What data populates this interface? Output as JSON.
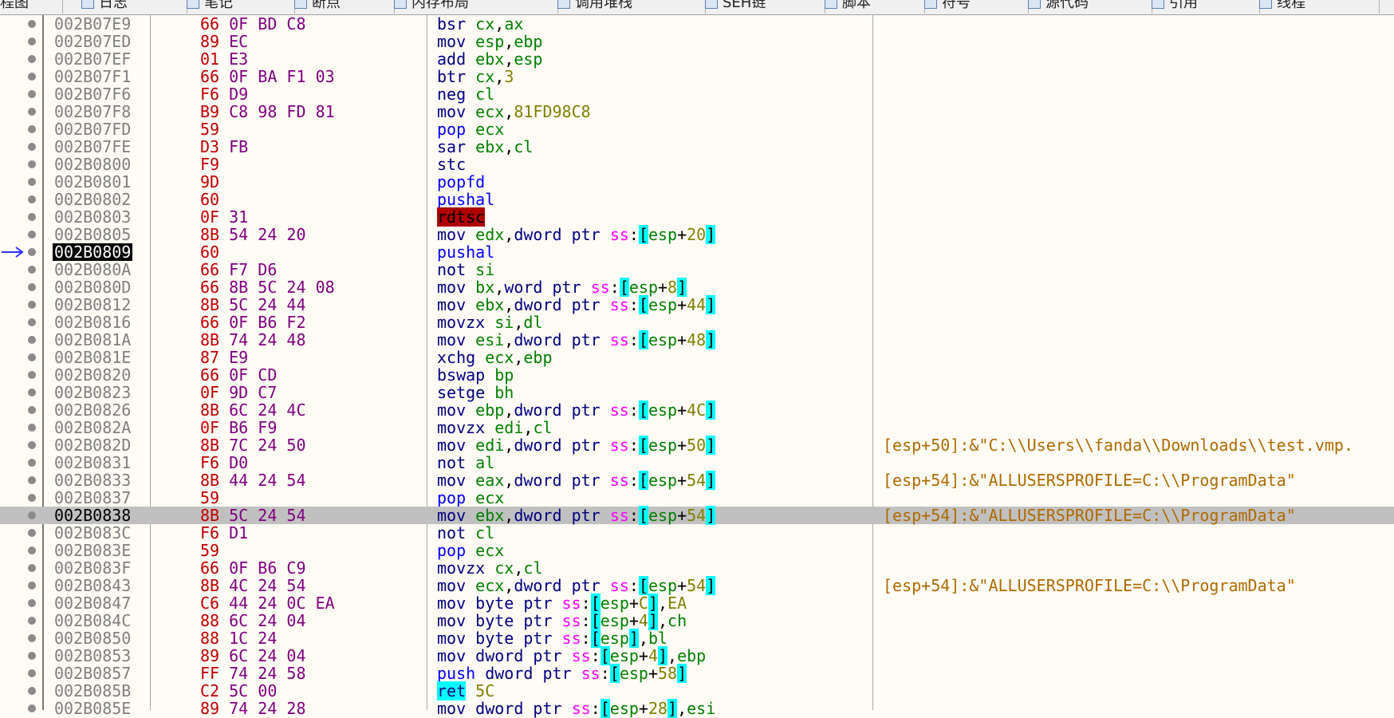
{
  "tabs": [
    {
      "label": "程图"
    },
    {
      "label": "日志"
    },
    {
      "label": "笔记"
    },
    {
      "label": "断点"
    },
    {
      "label": "内存布局"
    },
    {
      "label": "调用堆栈"
    },
    {
      "label": "SEH链"
    },
    {
      "label": "脚本"
    },
    {
      "label": "符号"
    },
    {
      "label": "源代码"
    },
    {
      "label": "引用"
    },
    {
      "label": "线程"
    }
  ],
  "current_ip_marker": "→",
  "rows": [
    {
      "addr": "002B07E9",
      "bytes": [
        "66",
        "0F",
        "BD",
        "C8"
      ],
      "mn": "bsr",
      "ops": [
        [
          "r",
          "cx"
        ],
        [
          "p",
          ","
        ],
        [
          "r",
          "ax"
        ]
      ]
    },
    {
      "addr": "002B07ED",
      "bytes": [
        "89",
        "EC"
      ],
      "mn": "mov",
      "ops": [
        [
          "r",
          "esp"
        ],
        [
          "p",
          ","
        ],
        [
          "r",
          "ebp"
        ]
      ]
    },
    {
      "addr": "002B07EF",
      "bytes": [
        "01",
        "E3"
      ],
      "mn": "add",
      "ops": [
        [
          "r",
          "ebx"
        ],
        [
          "p",
          ","
        ],
        [
          "r",
          "esp"
        ]
      ]
    },
    {
      "addr": "002B07F1",
      "bytes": [
        "66",
        "0F",
        "BA",
        "F1",
        "03"
      ],
      "mn": "btr",
      "ops": [
        [
          "r",
          "cx"
        ],
        [
          "p",
          ","
        ],
        [
          "n",
          "3"
        ]
      ]
    },
    {
      "addr": "002B07F6",
      "bytes": [
        "F6",
        "D9"
      ],
      "mn": "neg",
      "ops": [
        [
          "r",
          "cl"
        ]
      ]
    },
    {
      "addr": "002B07F8",
      "bytes": [
        "B9",
        "C8",
        "98",
        "FD",
        "81"
      ],
      "mn": "mov",
      "ops": [
        [
          "r",
          "ecx"
        ],
        [
          "p",
          ","
        ],
        [
          "n",
          "81FD98C8"
        ]
      ]
    },
    {
      "addr": "002B07FD",
      "bytes": [
        "59"
      ],
      "mn": "pop",
      "mnc": "push",
      "ops": [
        [
          "r",
          "ecx"
        ]
      ]
    },
    {
      "addr": "002B07FE",
      "bytes": [
        "D3",
        "FB"
      ],
      "mn": "sar",
      "ops": [
        [
          "r",
          "ebx"
        ],
        [
          "p",
          ","
        ],
        [
          "r",
          "cl"
        ]
      ]
    },
    {
      "addr": "002B0800",
      "bytes": [
        "F9"
      ],
      "mn": "stc",
      "ops": []
    },
    {
      "addr": "002B0801",
      "bytes": [
        "9D"
      ],
      "mn": "popfd",
      "mnc": "push",
      "ops": []
    },
    {
      "addr": "002B0802",
      "bytes": [
        "60"
      ],
      "mn": "pushal",
      "mnc": "push",
      "ops": []
    },
    {
      "addr": "002B0803",
      "bytes": [
        "0F",
        "31"
      ],
      "mn": "rdtsc",
      "mnc": "red",
      "ops": []
    },
    {
      "addr": "002B0805",
      "bytes": [
        "8B",
        "54",
        "24",
        "20"
      ],
      "mn": "mov",
      "ops": [
        [
          "r",
          "edx"
        ],
        [
          "p",
          ","
        ],
        [
          "k",
          "dword ptr "
        ],
        [
          "s",
          "ss"
        ],
        [
          "p",
          ":"
        ],
        [
          "b",
          "["
        ],
        [
          "r",
          "esp"
        ],
        [
          "p",
          "+"
        ],
        [
          "n",
          "20"
        ],
        [
          "b",
          "]"
        ]
      ]
    },
    {
      "addr": "002B0809",
      "bytes": [
        "60"
      ],
      "mn": "pushal",
      "mnc": "push",
      "ops": [],
      "current": true
    },
    {
      "addr": "002B080A",
      "bytes": [
        "66",
        "F7",
        "D6"
      ],
      "mn": "not",
      "ops": [
        [
          "r",
          "si"
        ]
      ]
    },
    {
      "addr": "002B080D",
      "bytes": [
        "66",
        "8B",
        "5C",
        "24",
        "08"
      ],
      "mn": "mov",
      "ops": [
        [
          "r",
          "bx"
        ],
        [
          "p",
          ","
        ],
        [
          "k",
          "word ptr "
        ],
        [
          "s",
          "ss"
        ],
        [
          "p",
          ":"
        ],
        [
          "b",
          "["
        ],
        [
          "r",
          "esp"
        ],
        [
          "p",
          "+"
        ],
        [
          "n",
          "8"
        ],
        [
          "b",
          "]"
        ]
      ]
    },
    {
      "addr": "002B0812",
      "bytes": [
        "8B",
        "5C",
        "24",
        "44"
      ],
      "mn": "mov",
      "ops": [
        [
          "r",
          "ebx"
        ],
        [
          "p",
          ","
        ],
        [
          "k",
          "dword ptr "
        ],
        [
          "s",
          "ss"
        ],
        [
          "p",
          ":"
        ],
        [
          "b",
          "["
        ],
        [
          "r",
          "esp"
        ],
        [
          "p",
          "+"
        ],
        [
          "n",
          "44"
        ],
        [
          "b",
          "]"
        ]
      ]
    },
    {
      "addr": "002B0816",
      "bytes": [
        "66",
        "0F",
        "B6",
        "F2"
      ],
      "mn": "movzx",
      "ops": [
        [
          "r",
          "si"
        ],
        [
          "p",
          ","
        ],
        [
          "r",
          "dl"
        ]
      ]
    },
    {
      "addr": "002B081A",
      "bytes": [
        "8B",
        "74",
        "24",
        "48"
      ],
      "mn": "mov",
      "ops": [
        [
          "r",
          "esi"
        ],
        [
          "p",
          ","
        ],
        [
          "k",
          "dword ptr "
        ],
        [
          "s",
          "ss"
        ],
        [
          "p",
          ":"
        ],
        [
          "b",
          "["
        ],
        [
          "r",
          "esp"
        ],
        [
          "p",
          "+"
        ],
        [
          "n",
          "48"
        ],
        [
          "b",
          "]"
        ]
      ]
    },
    {
      "addr": "002B081E",
      "bytes": [
        "87",
        "E9"
      ],
      "mn": "xchg",
      "ops": [
        [
          "r",
          "ecx"
        ],
        [
          "p",
          ","
        ],
        [
          "r",
          "ebp"
        ]
      ]
    },
    {
      "addr": "002B0820",
      "bytes": [
        "66",
        "0F",
        "CD"
      ],
      "mn": "bswap",
      "ops": [
        [
          "r",
          "bp"
        ]
      ]
    },
    {
      "addr": "002B0823",
      "bytes": [
        "0F",
        "9D",
        "C7"
      ],
      "mn": "setge",
      "ops": [
        [
          "r",
          "bh"
        ]
      ]
    },
    {
      "addr": "002B0826",
      "bytes": [
        "8B",
        "6C",
        "24",
        "4C"
      ],
      "mn": "mov",
      "ops": [
        [
          "r",
          "ebp"
        ],
        [
          "p",
          ","
        ],
        [
          "k",
          "dword ptr "
        ],
        [
          "s",
          "ss"
        ],
        [
          "p",
          ":"
        ],
        [
          "b",
          "["
        ],
        [
          "r",
          "esp"
        ],
        [
          "p",
          "+"
        ],
        [
          "n",
          "4C"
        ],
        [
          "b",
          "]"
        ]
      ]
    },
    {
      "addr": "002B082A",
      "bytes": [
        "0F",
        "B6",
        "F9"
      ],
      "mn": "movzx",
      "ops": [
        [
          "r",
          "edi"
        ],
        [
          "p",
          ","
        ],
        [
          "r",
          "cl"
        ]
      ]
    },
    {
      "addr": "002B082D",
      "bytes": [
        "8B",
        "7C",
        "24",
        "50"
      ],
      "mn": "mov",
      "ops": [
        [
          "r",
          "edi"
        ],
        [
          "p",
          ","
        ],
        [
          "k",
          "dword ptr "
        ],
        [
          "s",
          "ss"
        ],
        [
          "p",
          ":"
        ],
        [
          "b",
          "["
        ],
        [
          "r",
          "esp"
        ],
        [
          "p",
          "+"
        ],
        [
          "n",
          "50"
        ],
        [
          "b",
          "]"
        ]
      ],
      "comment": "[esp+50]:&\"C:\\\\Users\\\\fanda\\\\Downloads\\\\test.vmp."
    },
    {
      "addr": "002B0831",
      "bytes": [
        "F6",
        "D0"
      ],
      "mn": "not",
      "ops": [
        [
          "r",
          "al"
        ]
      ]
    },
    {
      "addr": "002B0833",
      "bytes": [
        "8B",
        "44",
        "24",
        "54"
      ],
      "mn": "mov",
      "ops": [
        [
          "r",
          "eax"
        ],
        [
          "p",
          ","
        ],
        [
          "k",
          "dword ptr "
        ],
        [
          "s",
          "ss"
        ],
        [
          "p",
          ":"
        ],
        [
          "b",
          "["
        ],
        [
          "r",
          "esp"
        ],
        [
          "p",
          "+"
        ],
        [
          "n",
          "54"
        ],
        [
          "b",
          "]"
        ]
      ],
      "comment": "[esp+54]:&\"ALLUSERSPROFILE=C:\\\\ProgramData\""
    },
    {
      "addr": "002B0837",
      "bytes": [
        "59"
      ],
      "mn": "pop",
      "mnc": "push",
      "ops": [
        [
          "r",
          "ecx"
        ]
      ]
    },
    {
      "addr": "002B0838",
      "bytes": [
        "8B",
        "5C",
        "24",
        "54"
      ],
      "mn": "mov",
      "ops": [
        [
          "r",
          "ebx"
        ],
        [
          "p",
          ","
        ],
        [
          "k",
          "dword ptr "
        ],
        [
          "s",
          "ss"
        ],
        [
          "p",
          ":"
        ],
        [
          "b",
          "["
        ],
        [
          "r",
          "esp"
        ],
        [
          "p",
          "+"
        ],
        [
          "n",
          "54"
        ],
        [
          "b",
          "]"
        ]
      ],
      "comment": "[esp+54]:&\"ALLUSERSPROFILE=C:\\\\ProgramData\"",
      "selected": true
    },
    {
      "addr": "002B083C",
      "bytes": [
        "F6",
        "D1"
      ],
      "mn": "not",
      "ops": [
        [
          "r",
          "cl"
        ]
      ]
    },
    {
      "addr": "002B083E",
      "bytes": [
        "59"
      ],
      "mn": "pop",
      "mnc": "push",
      "ops": [
        [
          "r",
          "ecx"
        ]
      ]
    },
    {
      "addr": "002B083F",
      "bytes": [
        "66",
        "0F",
        "B6",
        "C9"
      ],
      "mn": "movzx",
      "ops": [
        [
          "r",
          "cx"
        ],
        [
          "p",
          ","
        ],
        [
          "r",
          "cl"
        ]
      ]
    },
    {
      "addr": "002B0843",
      "bytes": [
        "8B",
        "4C",
        "24",
        "54"
      ],
      "mn": "mov",
      "ops": [
        [
          "r",
          "ecx"
        ],
        [
          "p",
          ","
        ],
        [
          "k",
          "dword ptr "
        ],
        [
          "s",
          "ss"
        ],
        [
          "p",
          ":"
        ],
        [
          "b",
          "["
        ],
        [
          "r",
          "esp"
        ],
        [
          "p",
          "+"
        ],
        [
          "n",
          "54"
        ],
        [
          "b",
          "]"
        ]
      ],
      "comment": "[esp+54]:&\"ALLUSERSPROFILE=C:\\\\ProgramData\""
    },
    {
      "addr": "002B0847",
      "bytes": [
        "C6",
        "44",
        "24",
        "0C",
        "EA"
      ],
      "mn": "mov",
      "ops": [
        [
          "k",
          "byte ptr "
        ],
        [
          "s",
          "ss"
        ],
        [
          "p",
          ":"
        ],
        [
          "b",
          "["
        ],
        [
          "r",
          "esp"
        ],
        [
          "p",
          "+"
        ],
        [
          "n",
          "C"
        ],
        [
          "b",
          "]"
        ],
        [
          "p",
          ","
        ],
        [
          "n",
          "EA"
        ]
      ]
    },
    {
      "addr": "002B084C",
      "bytes": [
        "88",
        "6C",
        "24",
        "04"
      ],
      "mn": "mov",
      "ops": [
        [
          "k",
          "byte ptr "
        ],
        [
          "s",
          "ss"
        ],
        [
          "p",
          ":"
        ],
        [
          "b",
          "["
        ],
        [
          "r",
          "esp"
        ],
        [
          "p",
          "+"
        ],
        [
          "n",
          "4"
        ],
        [
          "b",
          "]"
        ],
        [
          "p",
          ","
        ],
        [
          "r",
          "ch"
        ]
      ]
    },
    {
      "addr": "002B0850",
      "bytes": [
        "88",
        "1C",
        "24"
      ],
      "mn": "mov",
      "ops": [
        [
          "k",
          "byte ptr "
        ],
        [
          "s",
          "ss"
        ],
        [
          "p",
          ":"
        ],
        [
          "b",
          "["
        ],
        [
          "r",
          "esp"
        ],
        [
          "b",
          "]"
        ],
        [
          "p",
          ","
        ],
        [
          "r",
          "bl"
        ]
      ]
    },
    {
      "addr": "002B0853",
      "bytes": [
        "89",
        "6C",
        "24",
        "04"
      ],
      "mn": "mov",
      "ops": [
        [
          "k",
          "dword ptr "
        ],
        [
          "s",
          "ss"
        ],
        [
          "p",
          ":"
        ],
        [
          "b",
          "["
        ],
        [
          "r",
          "esp"
        ],
        [
          "p",
          "+"
        ],
        [
          "n",
          "4"
        ],
        [
          "b",
          "]"
        ],
        [
          "p",
          ","
        ],
        [
          "r",
          "ebp"
        ]
      ]
    },
    {
      "addr": "002B0857",
      "bytes": [
        "FF",
        "74",
        "24",
        "58"
      ],
      "mn": "push",
      "mnc": "push",
      "ops": [
        [
          "k",
          "dword ptr "
        ],
        [
          "s",
          "ss"
        ],
        [
          "p",
          ":"
        ],
        [
          "b",
          "["
        ],
        [
          "r",
          "esp"
        ],
        [
          "p",
          "+"
        ],
        [
          "n",
          "58"
        ],
        [
          "b",
          "]"
        ]
      ]
    },
    {
      "addr": "002B085B",
      "bytes": [
        "C2",
        "5C",
        "00"
      ],
      "mn": "ret",
      "mnc": "cy",
      "ops": [
        [
          "n",
          "5C"
        ]
      ]
    },
    {
      "addr": "002B085E",
      "bytes": [
        "89",
        "74",
        "24",
        "28"
      ],
      "mn": "mov",
      "ops": [
        [
          "k",
          "dword ptr "
        ],
        [
          "s",
          "ss"
        ],
        [
          "p",
          ":"
        ],
        [
          "b",
          "["
        ],
        [
          "r",
          "esp"
        ],
        [
          "p",
          "+"
        ],
        [
          "n",
          "28"
        ],
        [
          "b",
          "]"
        ],
        [
          "p",
          ","
        ],
        [
          "r",
          "esi"
        ]
      ]
    }
  ]
}
